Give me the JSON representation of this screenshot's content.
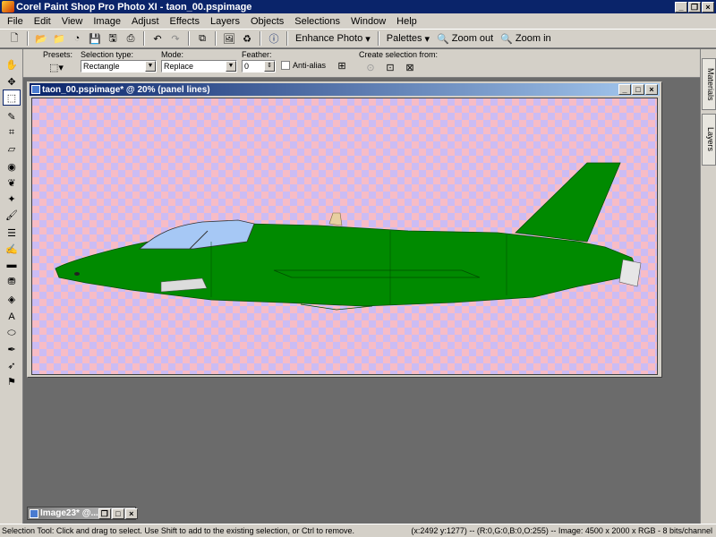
{
  "app": {
    "title": "Corel Paint Shop Pro Photo XI - taon_00.pspimage"
  },
  "menu": [
    "File",
    "Edit",
    "View",
    "Image",
    "Adjust",
    "Effects",
    "Layers",
    "Objects",
    "Selections",
    "Window",
    "Help"
  ],
  "toolbar": {
    "enhance_photo": "Enhance Photo",
    "palettes": "Palettes",
    "zoom_out": "Zoom out",
    "zoom_in": "Zoom in"
  },
  "tool_options": {
    "presets_label": "Presets:",
    "selection_type_label": "Selection type:",
    "selection_type_value": "Rectangle",
    "mode_label": "Mode:",
    "mode_value": "Replace",
    "feather_label": "Feather:",
    "feather_value": "0",
    "antialias_label": "Anti-alias",
    "create_selection_label": "Create selection from:"
  },
  "right_tabs": {
    "materials": "Materials",
    "layers": "Layers"
  },
  "document": {
    "title": "taon_00.pspimage* @  20% (panel lines)"
  },
  "minimized_doc": {
    "title": "Image23* @..."
  },
  "status": {
    "left": "Selection Tool: Click and drag to select. Use Shift to add to the existing selection, or Ctrl to remove.",
    "right": "(x:2492 y:1277) -- (R:0,G:0,B:0,O:255) -- Image:  4500 x 2000 x RGB - 8 bits/channel"
  },
  "colors": {
    "aircraft": "#008a00",
    "canopy": "#a6c8f5",
    "title_active": "#0a246a"
  }
}
